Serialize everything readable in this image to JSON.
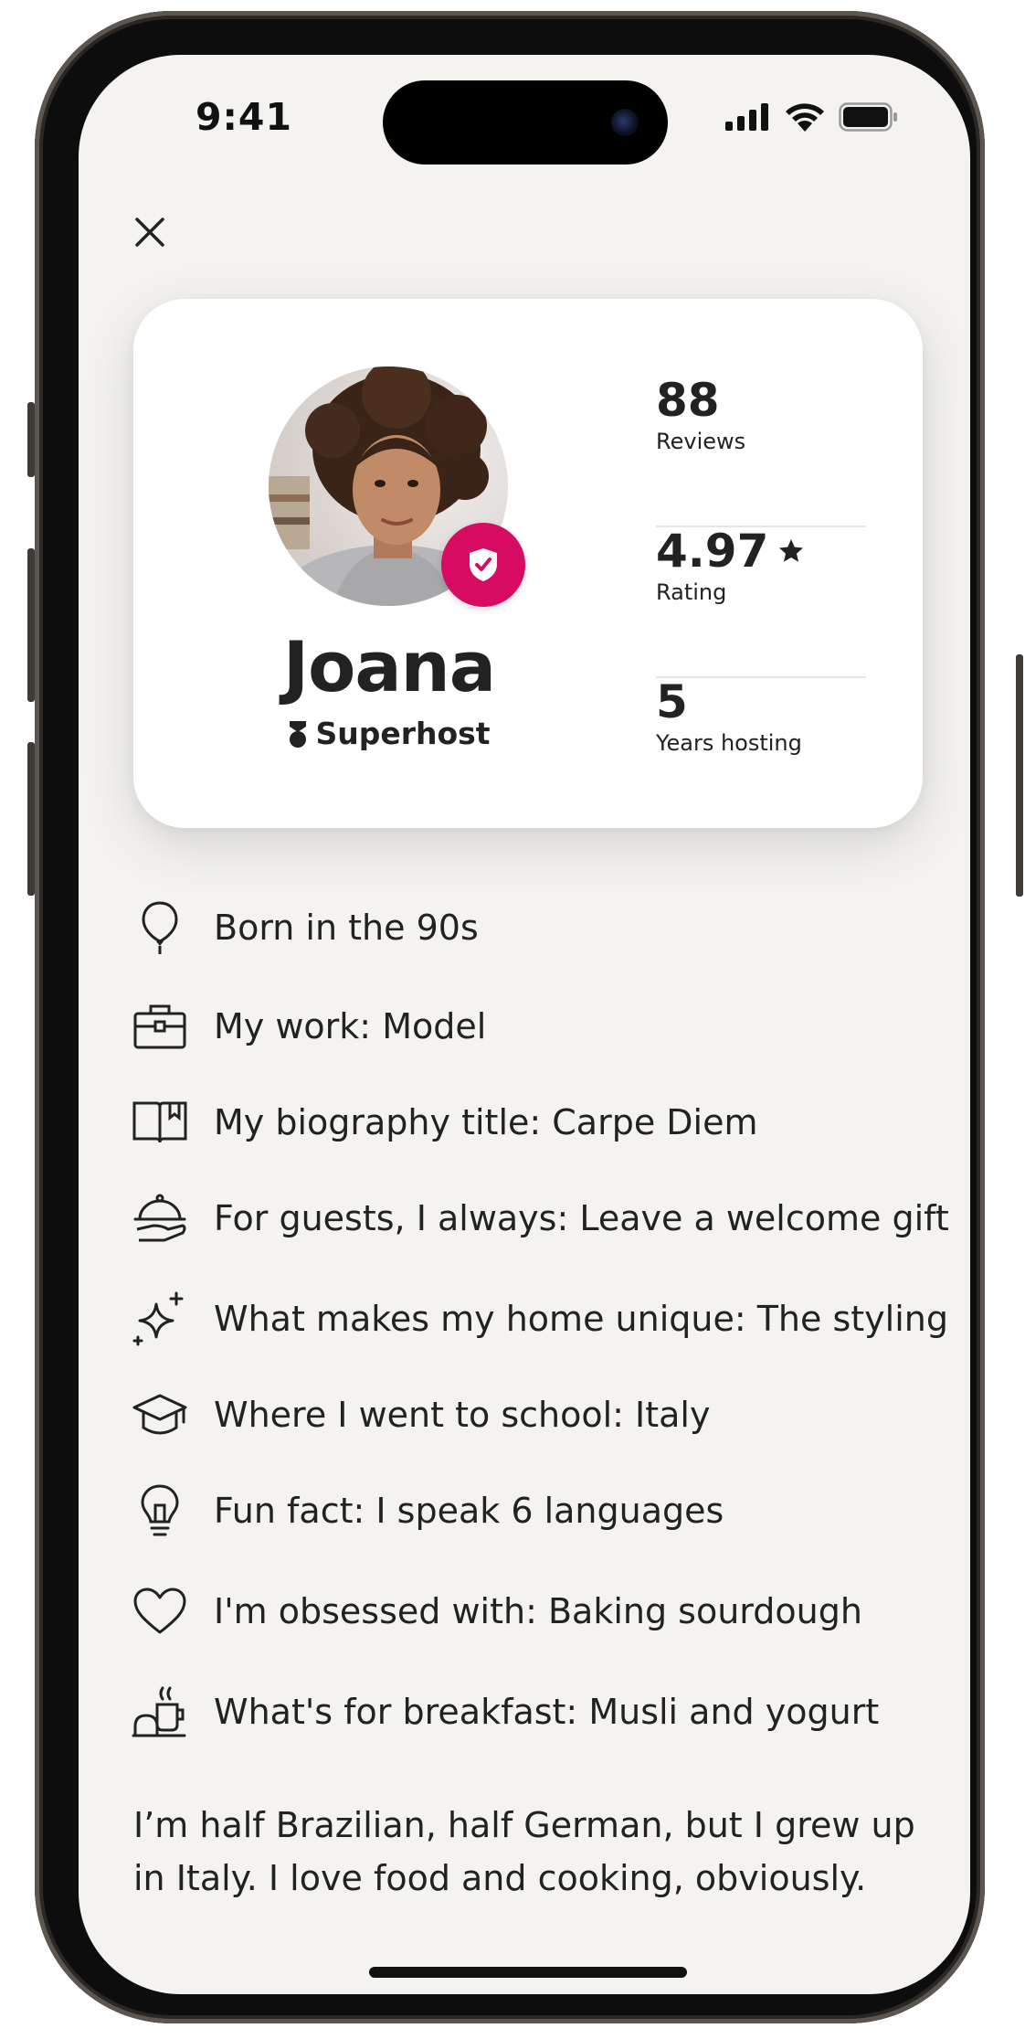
{
  "status_bar": {
    "time": "9:41"
  },
  "profile": {
    "name": "Joana",
    "superhost_label": "Superhost",
    "stats": [
      {
        "value": "88",
        "label": "Reviews"
      },
      {
        "value": "4.97",
        "label": "Rating",
        "icon": "star-icon"
      },
      {
        "value": "5",
        "label": "Years hosting"
      }
    ]
  },
  "facts": [
    {
      "icon": "balloon-icon",
      "text": "Born in the 90s"
    },
    {
      "icon": "briefcase-icon",
      "text": "My work: Model"
    },
    {
      "icon": "book-icon",
      "text": "My biography title: Carpe Diem"
    },
    {
      "icon": "cloche-icon",
      "text": "For guests, I always: Leave a welcome gift"
    },
    {
      "icon": "sparkles-icon",
      "text": "What makes my home unique: The styling"
    },
    {
      "icon": "graduation-cap-icon",
      "text": "Where I went to school: Italy"
    },
    {
      "icon": "lightbulb-icon",
      "text": "Fun fact: I speak 6 languages"
    },
    {
      "icon": "heart-icon",
      "text": "I'm obsessed with: Baking sourdough"
    },
    {
      "icon": "breakfast-icon",
      "text": "What's for breakfast: Musli and yogurt"
    }
  ],
  "bio": "I’m half Brazilian, half German, but I grew up in Italy. I love food and cooking, obviously.",
  "colors": {
    "accent": "#D80B63",
    "background": "#F4F3F0",
    "text": "#222222"
  }
}
